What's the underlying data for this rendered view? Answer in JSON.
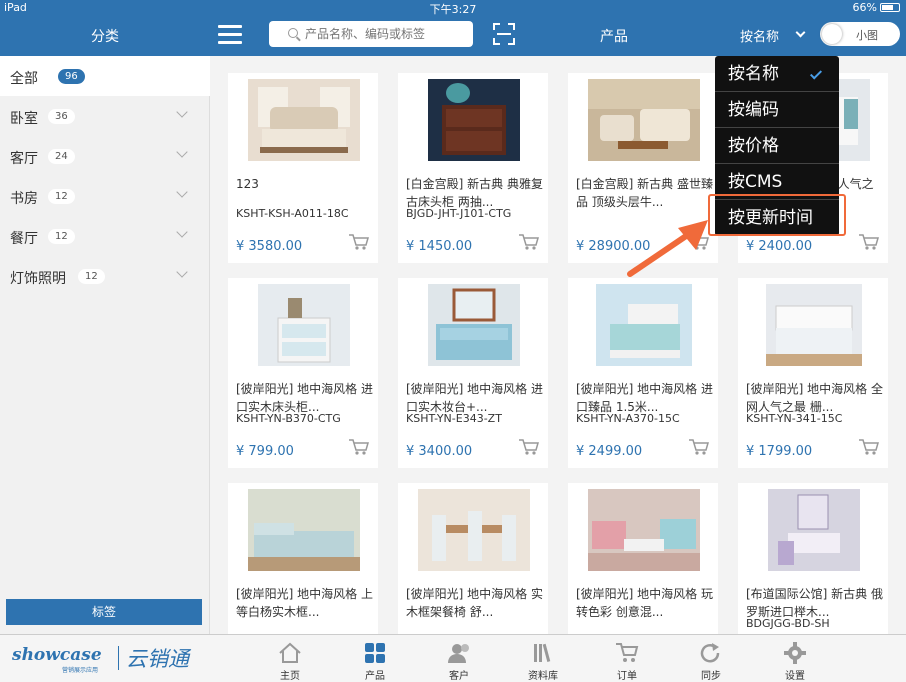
{
  "status": {
    "device": "iPad",
    "time": "下午3:27",
    "battery": "66%"
  },
  "header": {
    "category_title": "分类",
    "search_placeholder": "产品名称、编码或标签",
    "title": "产品",
    "sort_label": "按名称",
    "view_toggle": "小图"
  },
  "sidebar": {
    "items": [
      {
        "label": "全部",
        "count": "96"
      },
      {
        "label": "卧室",
        "count": "36"
      },
      {
        "label": "客厅",
        "count": "24"
      },
      {
        "label": "书房",
        "count": "12"
      },
      {
        "label": "餐厅",
        "count": "12"
      },
      {
        "label": "灯饰照明",
        "count": "12"
      }
    ],
    "tag_button": "标签"
  },
  "sort_menu": {
    "options": [
      "按名称",
      "按编码",
      "按价格",
      "按CMS",
      "按更新时间"
    ],
    "selected": "按名称",
    "highlighted": "按更新时间"
  },
  "products": [
    {
      "name": "123",
      "code": "KSHT-KSH-A011-18C",
      "price": "¥ 3580.00"
    },
    {
      "name": "[白金宫殿] 新古典 典雅复古床头柜 两抽...",
      "code": "BJGD-JHT-J101-CTG",
      "price": "¥ 1450.00"
    },
    {
      "name": "[白金宫殿] 新古典 盛世臻品 顶级头层牛...",
      "code": "",
      "price": "¥ 28900.00"
    },
    {
      "name": "地中海风 格 全网人气之最 按双...",
      "code": "",
      "price": "¥ 2400.00"
    },
    {
      "name": "[彼岸阳光] 地中海风格 进口实木床头柜...",
      "code": "KSHT-YN-B370-CTG",
      "price": "¥ 799.00"
    },
    {
      "name": "[彼岸阳光] 地中海风格 进口实木妆台+...",
      "code": "KSHT-YN-E343-ZT",
      "price": "¥ 3400.00"
    },
    {
      "name": "[彼岸阳光] 地中海风格 进口臻品 1.5米...",
      "code": "KSHT-YN-A370-15C",
      "price": "¥ 2499.00"
    },
    {
      "name": "[彼岸阳光] 地中海风格 全网人气之最 栅...",
      "code": "KSHT-YN-341-15C",
      "price": "¥ 1799.00"
    },
    {
      "name": "[彼岸阳光] 地中海风格 上等白杨实木框...",
      "code": "",
      "price": ""
    },
    {
      "name": "[彼岸阳光] 地中海风格 实木框架餐椅 舒...",
      "code": "",
      "price": ""
    },
    {
      "name": "[彼岸阳光] 地中海风格 玩转色彩 创意混...",
      "code": "",
      "price": ""
    },
    {
      "name": "[布道国际公馆] 新古典 俄罗斯进口榉木...",
      "code": "BDGJGG-BD-SH",
      "price": ""
    }
  ],
  "tabs": [
    "主页",
    "产品",
    "客户",
    "资料库",
    "订单",
    "同步",
    "设置"
  ],
  "brand": {
    "name": "showcase",
    "sub": "营销展示应用",
    "cn": "云销通"
  },
  "colors": {
    "accent": "#2e73b0",
    "highlight": "#f06a3a"
  }
}
